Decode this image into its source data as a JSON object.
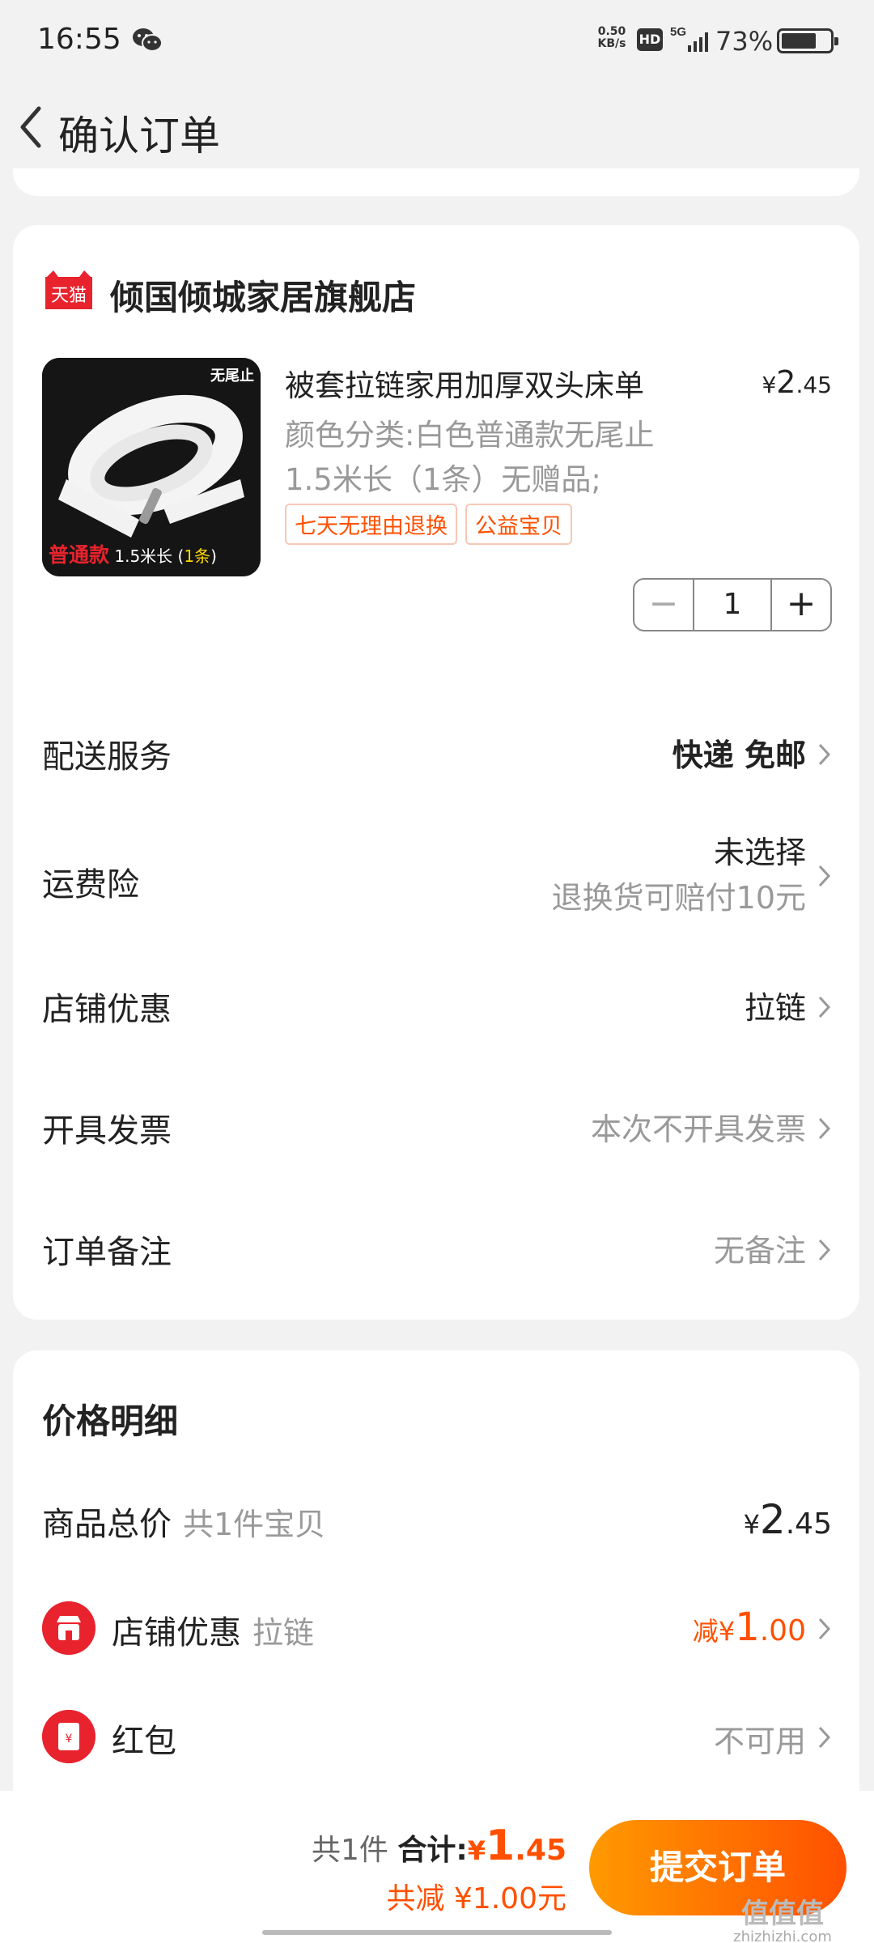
{
  "status_bar": {
    "time": "16:55",
    "net_speed_value": "0.50",
    "net_speed_unit": "KB/s",
    "hd": "HD",
    "network": "5G",
    "battery": "73%",
    "battery_level": 0.73
  },
  "header": {
    "title": "确认订单",
    "back_icon": "chevron-left-icon"
  },
  "store": {
    "badge": "天猫",
    "name": "倾国倾城家居旗舰店",
    "product": {
      "image_label_top": "无尾止",
      "image_label_bottom_red": "普通款",
      "image_label_bottom_white": "1.5米长 (",
      "image_label_bottom_yellow": "1条",
      "image_label_bottom_close": ")",
      "name": "被套拉链家用加厚双头床单",
      "price_symbol": "¥",
      "price_int": "2",
      "price_dec": ".45",
      "spec_line1": "颜色分类:白色普通款无尾止",
      "spec_line2": "1.5米长（1条）无赠品;",
      "tags": [
        "七天无理由退换",
        "公益宝贝"
      ],
      "quantity": "1",
      "minus": "−",
      "plus": "+"
    },
    "rows": {
      "delivery": {
        "label": "配送服务",
        "value": "快递 免邮"
      },
      "insurance": {
        "label": "运费险",
        "value": "未选择",
        "sub": "退换货可赔付10元"
      },
      "discount": {
        "label": "店铺优惠",
        "value": "拉链"
      },
      "invoice": {
        "label": "开具发票",
        "value": "本次不开具发票"
      },
      "note": {
        "label": "订单备注",
        "value": "无备注"
      }
    }
  },
  "price_detail": {
    "title": "价格明细",
    "total": {
      "label": "商品总价",
      "sub": "共1件宝贝",
      "symbol": "¥",
      "int": "2",
      "dec": ".45"
    },
    "shop_discount": {
      "label": "店铺优惠",
      "sub": "拉链",
      "prefix": "减",
      "symbol": "¥",
      "int": "1",
      "dec": ".00"
    },
    "red_packet": {
      "label": "红包",
      "value": "不可用",
      "icon_glyph": "¥"
    }
  },
  "bottom_bar": {
    "count": "共1件",
    "total_label": "合计:",
    "total_symbol": "¥",
    "total_int": "1",
    "total_dec": ".45",
    "saved": "共减 ¥1.00元",
    "submit": "提交订单"
  },
  "watermark": {
    "big": "值值值",
    "small": "zhizhizhi.com"
  },
  "colors": {
    "accent": "#ff5000",
    "button_start": "#ff9a00",
    "tmall_red": "#e8232e",
    "background": "#f2f2f2"
  }
}
